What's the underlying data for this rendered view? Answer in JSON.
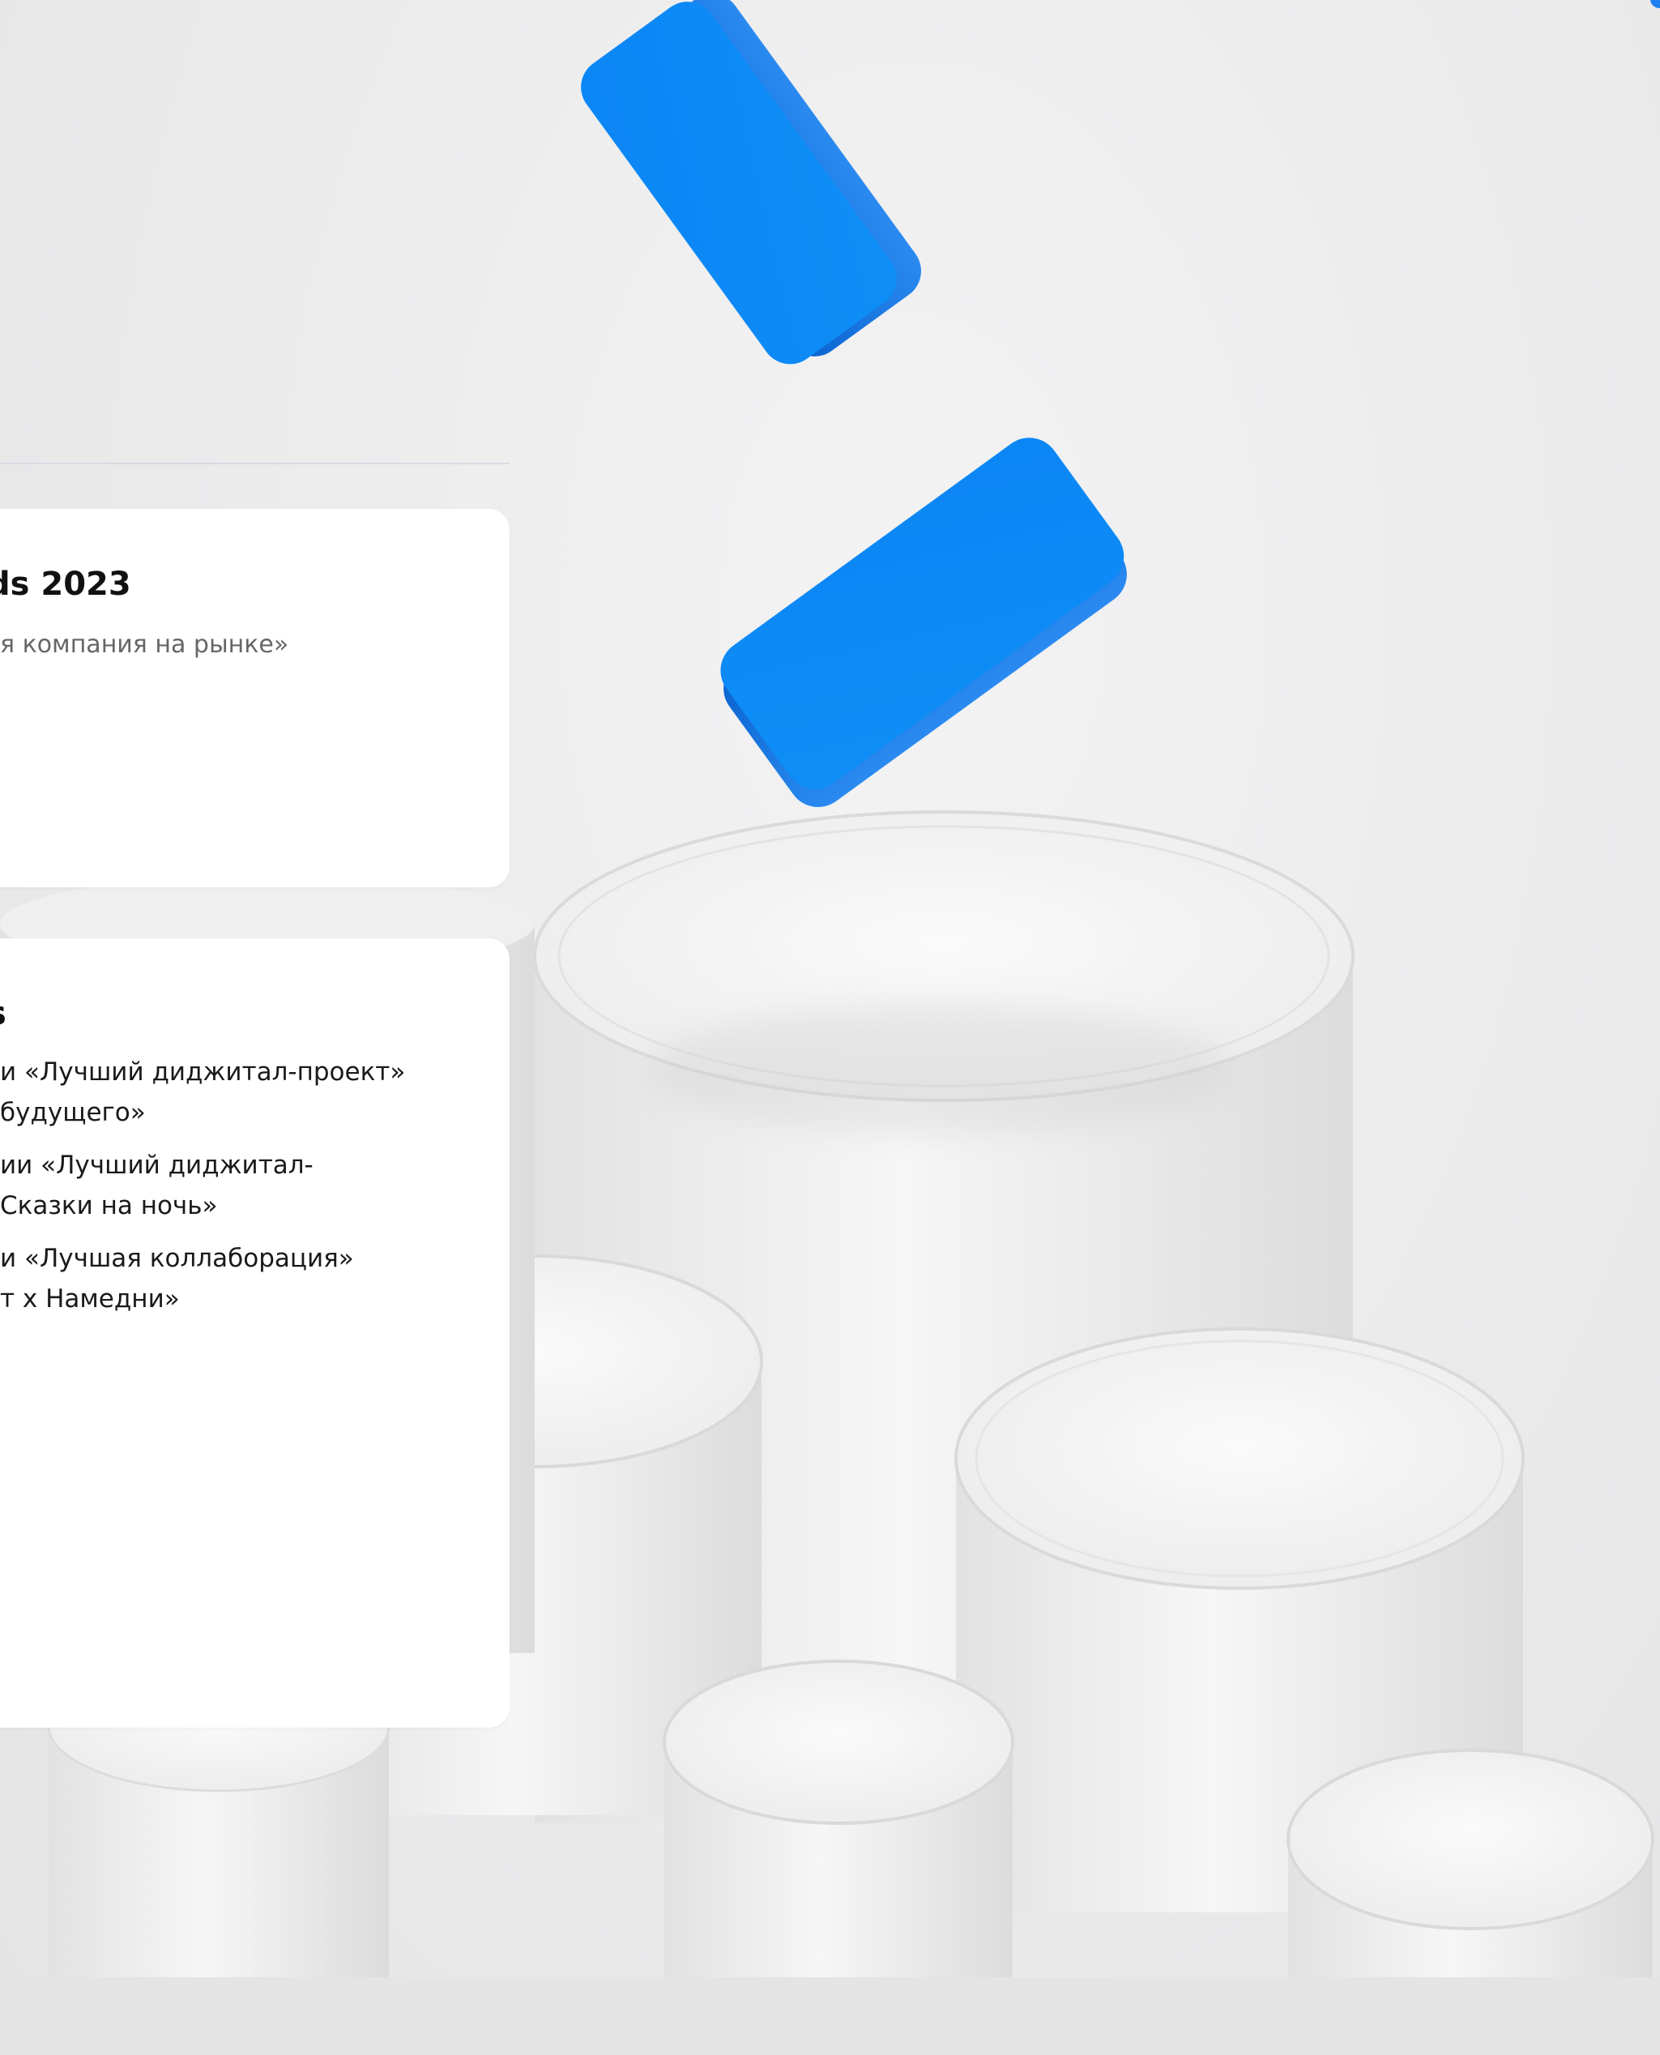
{
  "background": {
    "colors": {
      "accent": "#0a84f5",
      "accent_dark": "#0a6fd8",
      "surface": "#ffffff",
      "backdrop": "#ececed"
    },
    "illustration": "blue-3d-logo-over-white-podium-cylinders"
  },
  "awards": [
    {
      "title": "ds 2023",
      "subtitle": "я компания на рынке»"
    },
    {
      "title": "s",
      "items": [
        "и «Лучший диджитал-проект»\n будущего»",
        "ии «Лучший диджитал-\nСказки на ночь»",
        "и «Лучшая коллаборация»\nт x Намедни»"
      ]
    }
  ]
}
